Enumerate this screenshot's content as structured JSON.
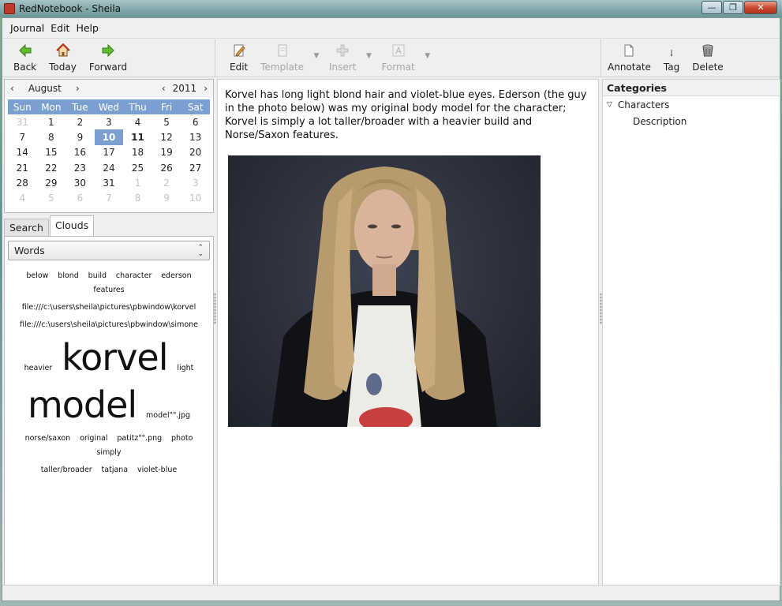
{
  "window": {
    "title": "RedNotebook - Sheila",
    "controls": {
      "minimize": "—",
      "maximize": "❐",
      "close": "✕"
    }
  },
  "menu": [
    "Journal",
    "Edit",
    "Help"
  ],
  "toolbar_left": [
    {
      "label": "Back",
      "icon": "arrow-left-icon"
    },
    {
      "label": "Today",
      "icon": "home-icon"
    },
    {
      "label": "Forward",
      "icon": "arrow-right-icon"
    }
  ],
  "toolbar_mid": [
    {
      "label": "Edit",
      "icon": "pencil-icon",
      "disabled": false
    },
    {
      "label": "Template",
      "icon": "template-icon",
      "disabled": true
    },
    {
      "label": "Insert",
      "icon": "plus-icon",
      "disabled": true
    },
    {
      "label": "Format",
      "icon": "format-icon",
      "disabled": true
    }
  ],
  "toolbar_right": [
    {
      "label": "Annotate",
      "icon": "document-icon"
    },
    {
      "label": "Tag",
      "icon": "tag-icon"
    },
    {
      "label": "Delete",
      "icon": "trash-icon"
    }
  ],
  "calendar": {
    "month": "August",
    "year": "2011",
    "prev": "‹",
    "next": "›",
    "weekdays": [
      "Sun",
      "Mon",
      "Tue",
      "Wed",
      "Thu",
      "Fri",
      "Sat"
    ],
    "weeks": [
      [
        "31",
        "1",
        "2",
        "3",
        "4",
        "5",
        "6"
      ],
      [
        "7",
        "8",
        "9",
        "10",
        "11",
        "12",
        "13"
      ],
      [
        "14",
        "15",
        "16",
        "17",
        "18",
        "19",
        "20"
      ],
      [
        "21",
        "22",
        "23",
        "24",
        "25",
        "26",
        "27"
      ],
      [
        "28",
        "29",
        "30",
        "31",
        "1",
        "2",
        "3"
      ],
      [
        "4",
        "5",
        "6",
        "7",
        "8",
        "9",
        "10"
      ]
    ],
    "selected_day": "10",
    "bold_days": [
      "10",
      "11"
    ]
  },
  "tabs": {
    "search": "Search",
    "clouds": "Clouds"
  },
  "clouds": {
    "combo_value": "Words",
    "line1": [
      "below",
      "blond",
      "build",
      "character",
      "ederson",
      "features"
    ],
    "line2": "file:///c:\\users\\sheila\\pictures\\pbwindow\\korvel",
    "line3": "file:///c:\\users\\sheila\\pictures\\pbwindow\\simone",
    "line4": {
      "left": "heavier",
      "big": "korvel",
      "right": "light"
    },
    "line5": {
      "big": "model",
      "right": "model\"\".jpg"
    },
    "line6": [
      "norse/saxon",
      "original",
      "patitz\"\".png",
      "photo",
      "simply"
    ],
    "line7": [
      "taller/broader",
      "tatjana",
      "violet-blue"
    ]
  },
  "entry": {
    "text": "Korvel has long light blond hair and violet-blue eyes. Ederson (the guy in the photo below) was my original body model for the character; Korvel is simply a lot taller/broader with a heavier build and Norse/Saxon features."
  },
  "categories": {
    "header": "Categories",
    "items": [
      {
        "label": "Characters",
        "expanded": true
      },
      {
        "label": "Description",
        "child": true
      }
    ]
  }
}
